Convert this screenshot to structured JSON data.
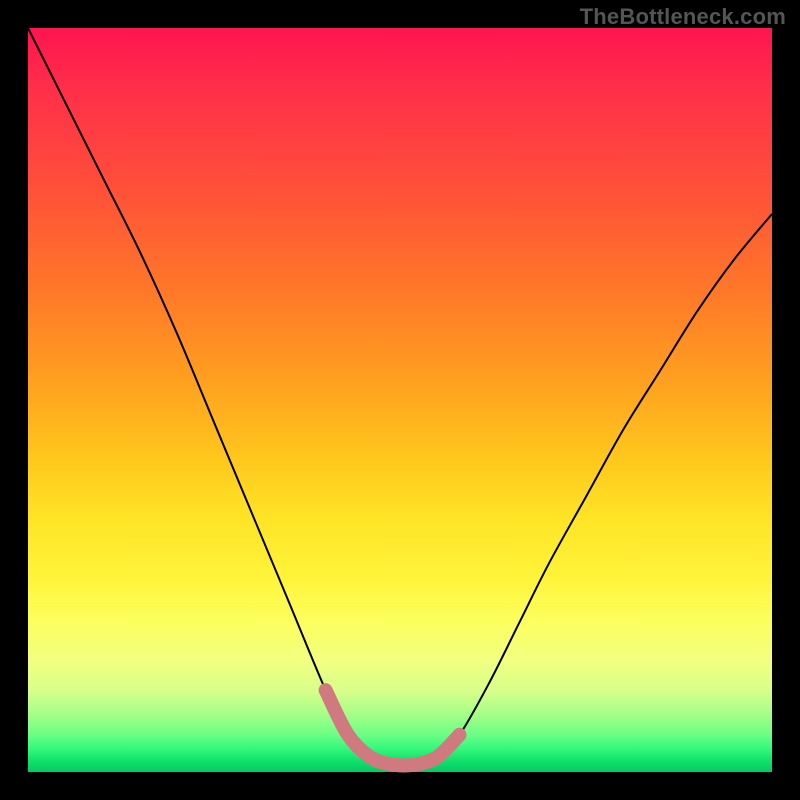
{
  "watermark": "TheBottleneck.com",
  "chart_data": {
    "type": "line",
    "title": "",
    "xlabel": "",
    "ylabel": "",
    "xlim": [
      0,
      100
    ],
    "ylim": [
      0,
      100
    ],
    "grid": false,
    "legend": false,
    "series": [
      {
        "name": "bottleneck-curve",
        "color": "#000000",
        "x": [
          0,
          5,
          10,
          15,
          20,
          25,
          30,
          35,
          40,
          43,
          46,
          49,
          52,
          55,
          58,
          62,
          66,
          70,
          75,
          80,
          85,
          90,
          95,
          100
        ],
        "values": [
          100,
          90,
          80,
          70,
          59,
          47,
          35,
          23,
          11,
          5,
          2,
          1,
          1,
          2,
          5,
          12,
          20,
          28,
          37,
          46,
          54,
          62,
          69,
          75
        ]
      },
      {
        "name": "optimal-zone-marker",
        "color": "#d07a80",
        "x": [
          40,
          43,
          46,
          49,
          52,
          55,
          58
        ],
        "values": [
          11,
          5,
          2,
          1,
          1,
          2,
          5
        ]
      }
    ],
    "annotations": []
  },
  "colors": {
    "page_bg": "#000000",
    "gradient_top": "#ff1450",
    "gradient_mid": "#ffe426",
    "gradient_bottom": "#00cc66",
    "curve": "#000000",
    "marker": "#d07a80",
    "watermark": "#555555"
  }
}
